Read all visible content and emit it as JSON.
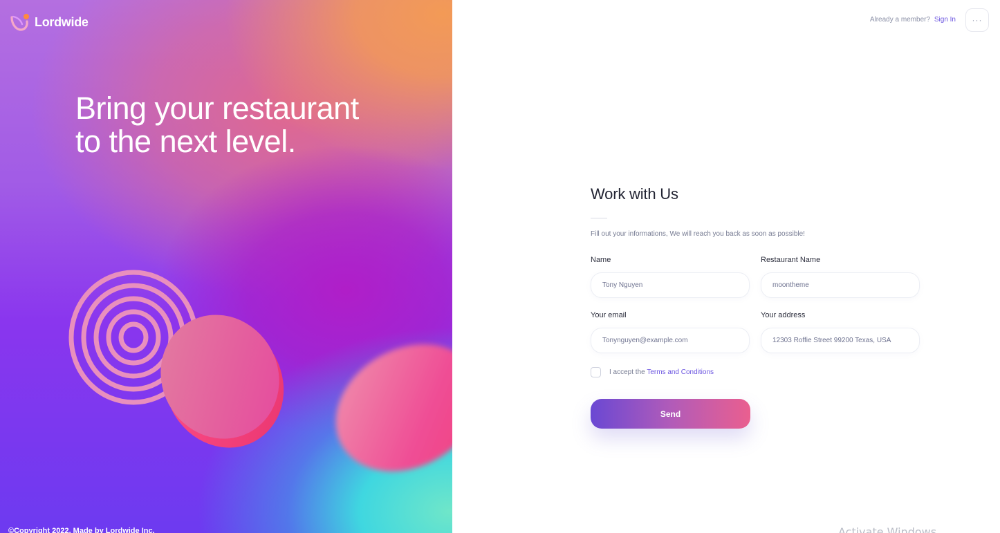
{
  "brand": {
    "name": "Lordwide"
  },
  "hero": {
    "headline_line1": "Bring your restaurant",
    "headline_line2": "to the next level.",
    "copyright": "©Copyright 2022, Made by Lordwide Inc."
  },
  "header": {
    "already_member": "Already a member?",
    "sign_in": "Sign In",
    "more_icon": "ellipsis-icon",
    "more_label": "···"
  },
  "form": {
    "title": "Work with Us",
    "subtitle": "Fill out your informations, We will reach you back as soon as possible!",
    "fields": {
      "name": {
        "label": "Name",
        "value": "Tony Nguyen"
      },
      "restaurant": {
        "label": "Restaurant Name",
        "value": "moontheme"
      },
      "email": {
        "label": "Your email",
        "value": "Tonynguyen@example.com"
      },
      "address": {
        "label": "Your address",
        "value": "12303 Roffie Street 99200 Texas, USA"
      }
    },
    "terms_prefix": "I accept the",
    "terms_link": "Terms and Conditions",
    "terms_checked": false,
    "send_label": "Send"
  },
  "os": {
    "watermark": "Activate Windows"
  },
  "colors": {
    "accent": "#6b55e0",
    "button_start": "#6a48d3",
    "button_end": "#ea5f8f"
  }
}
